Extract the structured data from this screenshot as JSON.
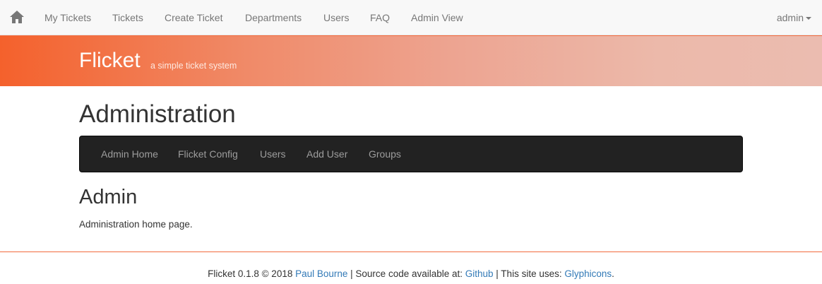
{
  "topnav": {
    "home_icon": "home-icon",
    "items": [
      "My Tickets",
      "Tickets",
      "Create Ticket",
      "Departments",
      "Users",
      "FAQ",
      "Admin View"
    ],
    "user_label": "admin"
  },
  "banner": {
    "brand": "Flicket",
    "tagline": "a simple ticket system"
  },
  "page": {
    "title": "Administration"
  },
  "admin_nav": {
    "items": [
      "Admin Home",
      "Flicket Config",
      "Users",
      "Add User",
      "Groups"
    ]
  },
  "section": {
    "title": "Admin",
    "text": "Administration home page."
  },
  "footer": {
    "prefix": "Flicket 0.1.8 © 2018 ",
    "author_link": "Paul Bourne",
    "mid1": " | Source code available at: ",
    "github_link": "Github",
    "mid2": " | This site uses: ",
    "glyph_link": "Glyphicons",
    "suffix": "."
  },
  "colors": {
    "accent": "#f26a3d",
    "banner_start": "#f4612c",
    "banner_end": "#ebbcb0",
    "link": "#337ab7",
    "admin_nav_bg": "#222222"
  }
}
